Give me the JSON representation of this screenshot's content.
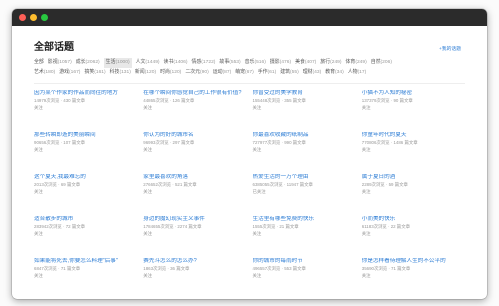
{
  "page_title": "全部话题",
  "all_topics_link": "+我的话题",
  "tag_rows": [
    [
      {
        "name": "全部",
        "count": ""
      },
      {
        "name": "影视",
        "count": "(1057)"
      },
      {
        "name": "成长",
        "count": "(2062)"
      },
      {
        "name": "生活",
        "count": "(1000)",
        "active": true
      },
      {
        "name": "人文",
        "count": "(1449)"
      },
      {
        "name": "读书",
        "count": "(1406)"
      },
      {
        "name": "情感",
        "count": "(1722)"
      },
      {
        "name": "故事",
        "count": "(553)"
      },
      {
        "name": "音乐",
        "count": "(516)"
      },
      {
        "name": "摄影",
        "count": "(476)"
      },
      {
        "name": "美食",
        "count": "(407)"
      },
      {
        "name": "旅行",
        "count": "(249)"
      },
      {
        "name": "体育",
        "count": "(249)"
      },
      {
        "name": "自然",
        "count": "(206)"
      }
    ],
    [
      {
        "name": "艺术",
        "count": "(180)"
      },
      {
        "name": "游戏",
        "count": "(167)"
      },
      {
        "name": "搞笑",
        "count": "(161)"
      },
      {
        "name": "科技",
        "count": "(131)"
      },
      {
        "name": "新闻",
        "count": "(120)"
      },
      {
        "name": "时尚",
        "count": "(120)"
      },
      {
        "name": "二次元",
        "count": "(90)"
      },
      {
        "name": "运动",
        "count": "(87)"
      },
      {
        "name": "萌宠",
        "count": "(67)"
      },
      {
        "name": "手作",
        "count": "(61)"
      },
      {
        "name": "建筑",
        "count": "(55)"
      },
      {
        "name": "理财",
        "count": "(43)"
      },
      {
        "name": "教育",
        "count": "(34)"
      },
      {
        "name": "人物",
        "count": "(17)"
      }
    ]
  ],
  "topics": [
    {
      "title": "因为某个作家的作品而向往的地方",
      "stats": "14979次浏览 · 430 篇文章",
      "follow": "关注"
    },
    {
      "title": "在哪个瞬间你感觉自己的工作很有价值?",
      "stats": "44865次浏览 · 126 篇文章",
      "follow": "关注"
    },
    {
      "title": "你曾受过的美学教育",
      "stats": "155448次浏览 · 355 篇文章",
      "follow": "关注"
    },
    {
      "title": "小猫不为人知的秘密",
      "stats": "137379次浏览 · 90 篇文章",
      "follow": "关注"
    },
    {
      "title": "那些转瞬即逝的美丽瞬间",
      "stats": "90656次浏览 · 107 篇文章",
      "follow": "关注"
    },
    {
      "title": "你认为的好的城市名",
      "stats": "96993次浏览 · 297 篇文章",
      "follow": "关注"
    },
    {
      "title": "你最喜欢收藏的纸制品",
      "stats": "727977次浏览 · 990 篇文章",
      "follow": "关注"
    },
    {
      "title": "你童年时代的夏天",
      "stats": "770806次浏览 · 1486 篇文章",
      "follow": "关注"
    },
    {
      "title": "这个夏天,我最难忘的",
      "stats": "2013次浏览 · 69 篇文章",
      "follow": "关注"
    },
    {
      "title": "家里最喜欢的角落",
      "stats": "276652次浏览 · 521 篇文章",
      "follow": "关注"
    },
    {
      "title": "热爱生活的一万个理由",
      "stats": "6385055次浏览 · 11947 篇文章",
      "follow": "已关注"
    },
    {
      "title": "属于夏日的酒",
      "stats": "2289次浏览 · 59 篇文章",
      "follow": "关注"
    },
    {
      "title": "适合散步的城市",
      "stats": "283942次浏览 · 72 篇文章",
      "follow": "关注"
    },
    {
      "title": "身边的魔幻现实主义事件",
      "stats": "1784655次浏览 · 2274 篇文章",
      "follow": "关注"
    },
    {
      "title": "生活里有哪些免费的快乐",
      "stats": "1555次浏览 · 21 篇文章",
      "follow": "关注"
    },
    {
      "title": "小而美的快乐",
      "stats": "61183次浏览 · 22 篇文章",
      "follow": "关注"
    },
    {
      "title": "如果能将死去,你要怎么料理\"后事\"",
      "stats": "6847次浏览 · 71 篇文章",
      "follow": "关注"
    },
    {
      "title": "赛先斗怎么的怎么办?",
      "stats": "1863次浏览 · 36 篇文章",
      "follow": "关注"
    },
    {
      "title": "你的城市的每雨时节",
      "stats": "496557次浏览 · 553 篇文章",
      "follow": "关注"
    },
    {
      "title": "你是怎样看待理解人生的不公平的",
      "stats": "35690次浏览 · 71 篇文章",
      "follow": "关注"
    }
  ]
}
